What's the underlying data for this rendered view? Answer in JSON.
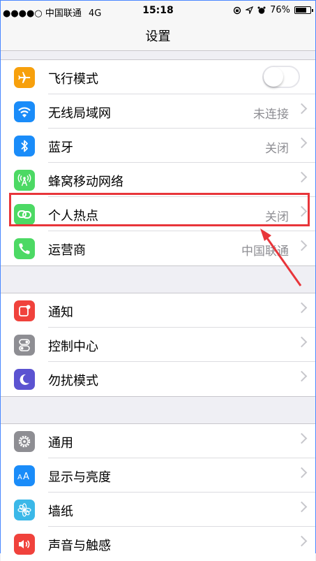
{
  "status_bar": {
    "signal": "●●●●○",
    "carrier": "中国联通",
    "network": "4G",
    "time": "15:18",
    "indicators": [
      "lock-rotation-icon",
      "location-icon",
      "alarm-icon"
    ],
    "battery_percent": "76%",
    "battery_level": 0.76
  },
  "nav": {
    "title": "设置"
  },
  "groups": [
    {
      "items": [
        {
          "label": "飞行模式",
          "icon": "airplane-icon",
          "color": "#f7a00c",
          "control": "toggle",
          "toggle_on": false
        },
        {
          "label": "无线局域网",
          "icon": "wifi-icon",
          "color": "#1a8cf9",
          "value": "未连接"
        },
        {
          "label": "蓝牙",
          "icon": "bluetooth-icon",
          "color": "#1a8cf9",
          "value": "关闭"
        },
        {
          "label": "蜂窝移动网络",
          "icon": "cellular-icon",
          "color": "#4cd964",
          "value": ""
        },
        {
          "label": "个人热点",
          "icon": "hotspot-icon",
          "color": "#4cd964",
          "value": "关闭"
        },
        {
          "label": "运营商",
          "icon": "phone-icon",
          "color": "#4cd964",
          "value": "中国联通"
        }
      ]
    },
    {
      "items": [
        {
          "label": "通知",
          "icon": "notifications-icon",
          "color": "#f0423c",
          "value": ""
        },
        {
          "label": "控制中心",
          "icon": "control-center-icon",
          "color": "#8e8e93",
          "value": ""
        },
        {
          "label": "勿扰模式",
          "icon": "moon-icon",
          "color": "#5b53d1",
          "value": ""
        }
      ]
    },
    {
      "items": [
        {
          "label": "通用",
          "icon": "gear-icon",
          "color": "#8e8e93",
          "value": ""
        },
        {
          "label": "显示与亮度",
          "icon": "display-brightness-icon",
          "color": "#1a8cf9",
          "value": ""
        },
        {
          "label": "墙纸",
          "icon": "wallpaper-icon",
          "color": "#3bb8e8",
          "value": ""
        },
        {
          "label": "声音与触感",
          "icon": "sounds-icon",
          "color": "#f0423c",
          "value": ""
        }
      ]
    }
  ],
  "annotation_color": "#e8353a"
}
